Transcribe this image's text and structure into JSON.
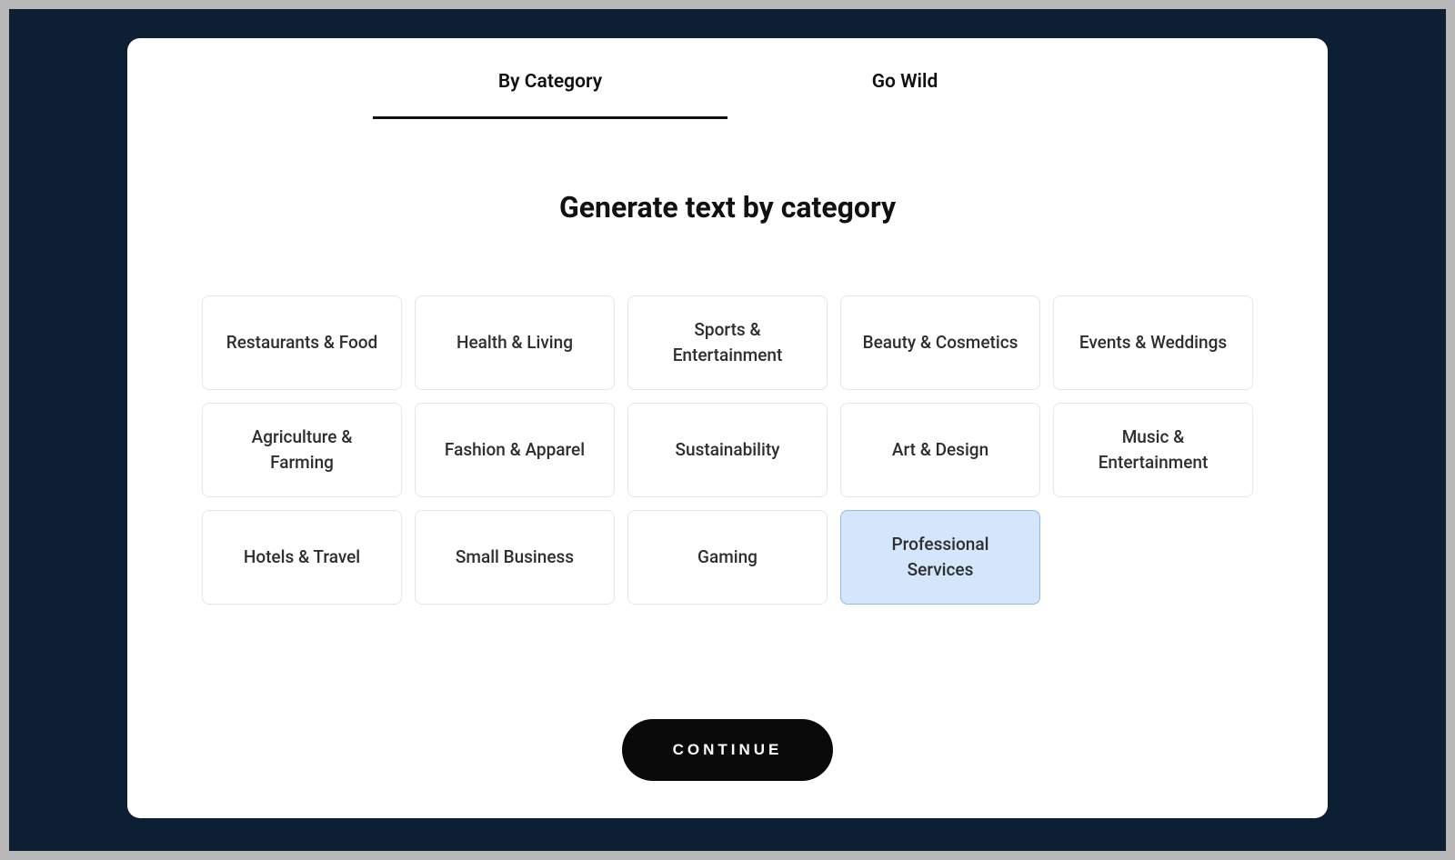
{
  "tabs": [
    {
      "label": "By Category",
      "active": true
    },
    {
      "label": "Go Wild",
      "active": false
    }
  ],
  "heading": "Generate text by category",
  "categories": [
    {
      "label": "Restaurants & Food",
      "selected": false
    },
    {
      "label": "Health & Living",
      "selected": false
    },
    {
      "label": "Sports & Entertainment",
      "selected": false
    },
    {
      "label": "Beauty & Cosmetics",
      "selected": false
    },
    {
      "label": "Events & Weddings",
      "selected": false
    },
    {
      "label": "Agriculture & Farming",
      "selected": false
    },
    {
      "label": "Fashion & Apparel",
      "selected": false
    },
    {
      "label": "Sustainability",
      "selected": false
    },
    {
      "label": "Art & Design",
      "selected": false
    },
    {
      "label": "Music & Entertainment",
      "selected": false
    },
    {
      "label": "Hotels & Travel",
      "selected": false
    },
    {
      "label": "Small Business",
      "selected": false
    },
    {
      "label": "Gaming",
      "selected": false
    },
    {
      "label": "Professional Services",
      "selected": true
    }
  ],
  "continue_label": "CONTINUE"
}
